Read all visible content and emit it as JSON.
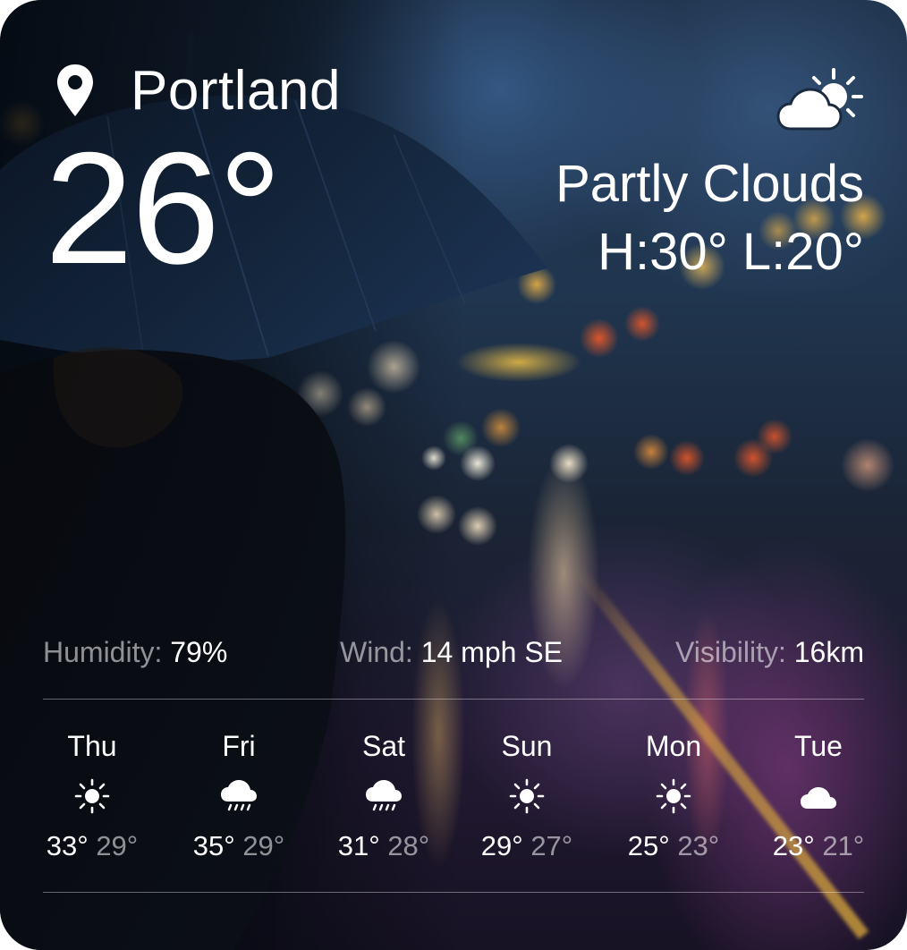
{
  "location": {
    "city": "Portland",
    "icon": "map-pin-icon"
  },
  "current": {
    "temperature": "26°",
    "condition": "Partly Clouds",
    "hilo": "H:30° L:20°",
    "icon": "partly-cloudy-icon"
  },
  "metrics": {
    "humidity": {
      "label": "Humidity:",
      "value": "79%"
    },
    "wind": {
      "label": "Wind:",
      "value": "14 mph SE"
    },
    "visibility": {
      "label": "Visibility:",
      "value": "16km"
    }
  },
  "forecast": [
    {
      "day": "Thu",
      "high": "33°",
      "low": "29°",
      "icon": "sun-icon"
    },
    {
      "day": "Fri",
      "high": "35°",
      "low": "29°",
      "icon": "rain-cloud-icon"
    },
    {
      "day": "Sat",
      "high": "31°",
      "low": "28°",
      "icon": "rain-cloud-icon"
    },
    {
      "day": "Sun",
      "high": "29°",
      "low": "27°",
      "icon": "sun-icon"
    },
    {
      "day": "Mon",
      "high": "25°",
      "low": "23°",
      "icon": "sun-icon"
    },
    {
      "day": "Tue",
      "high": "23°",
      "low": "21°",
      "icon": "cloud-icon"
    }
  ],
  "colors": {
    "text": "#ffffff",
    "muted_text": "#9a9ea6",
    "divider": "#8e949c"
  }
}
